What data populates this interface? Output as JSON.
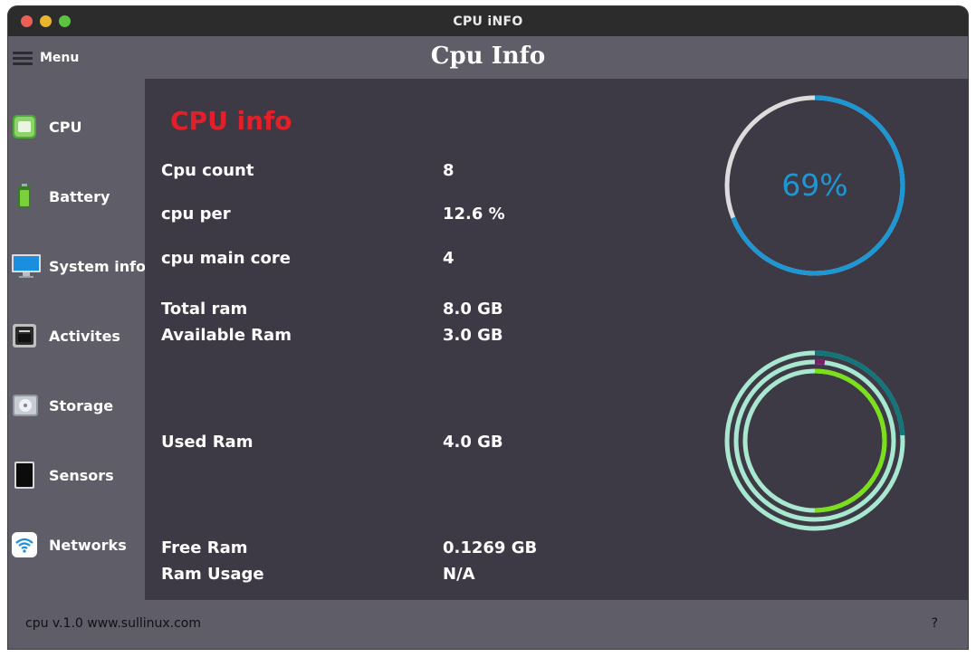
{
  "window": {
    "title": "CPU iNFO"
  },
  "header": {
    "menu_label": "Menu",
    "app_title": "Cpu Info"
  },
  "sidebar": {
    "items": [
      {
        "label": "CPU",
        "icon": "cpu-icon"
      },
      {
        "label": "Battery",
        "icon": "battery-icon"
      },
      {
        "label": "System info",
        "icon": "monitor-icon"
      },
      {
        "label": "Activites",
        "icon": "network-port-icon"
      },
      {
        "label": "Storage",
        "icon": "hard-drive-icon"
      },
      {
        "label": "Sensors",
        "icon": "tablet-icon"
      },
      {
        "label": "Networks",
        "icon": "wifi-icon"
      }
    ]
  },
  "main": {
    "section_title": "CPU info",
    "rows": [
      {
        "label": "Cpu count",
        "value": "8"
      },
      {
        "label": "cpu per",
        "value": "12.6 %"
      },
      {
        "label": "cpu main core",
        "value": "4"
      },
      {
        "label": "Total ram",
        "value": "8.0 GB"
      },
      {
        "label": "Available Ram",
        "value": "3.0 GB"
      },
      {
        "label": "Used Ram",
        "value": "4.0 GB"
      },
      {
        "label": "Free Ram",
        "value": "0.1269 GB"
      },
      {
        "label": "Ram Usage",
        "value": "N/A"
      }
    ],
    "cpu_gauge": {
      "text": "69%",
      "fraction": 0.69,
      "color": "#1c97d4",
      "track_color": "#dcdcdc"
    },
    "ram_gauge": {
      "rings": [
        {
          "fraction": 0.24,
          "color": "#11757a",
          "track_color": "#a8e8d0"
        },
        {
          "fraction": 0.02,
          "color": "#7a1f6e",
          "track_color": "#a8e8d0"
        },
        {
          "fraction": 0.5,
          "color": "#7be01a",
          "track_color": "#a8e8d0"
        }
      ]
    }
  },
  "footer": {
    "text": "cpu v.1.0 www.sullinux.com",
    "help_label": "?"
  },
  "colors": {
    "accent_red": "#e3202a",
    "panel": "#3d3a46",
    "chrome": "#5f5d67"
  }
}
